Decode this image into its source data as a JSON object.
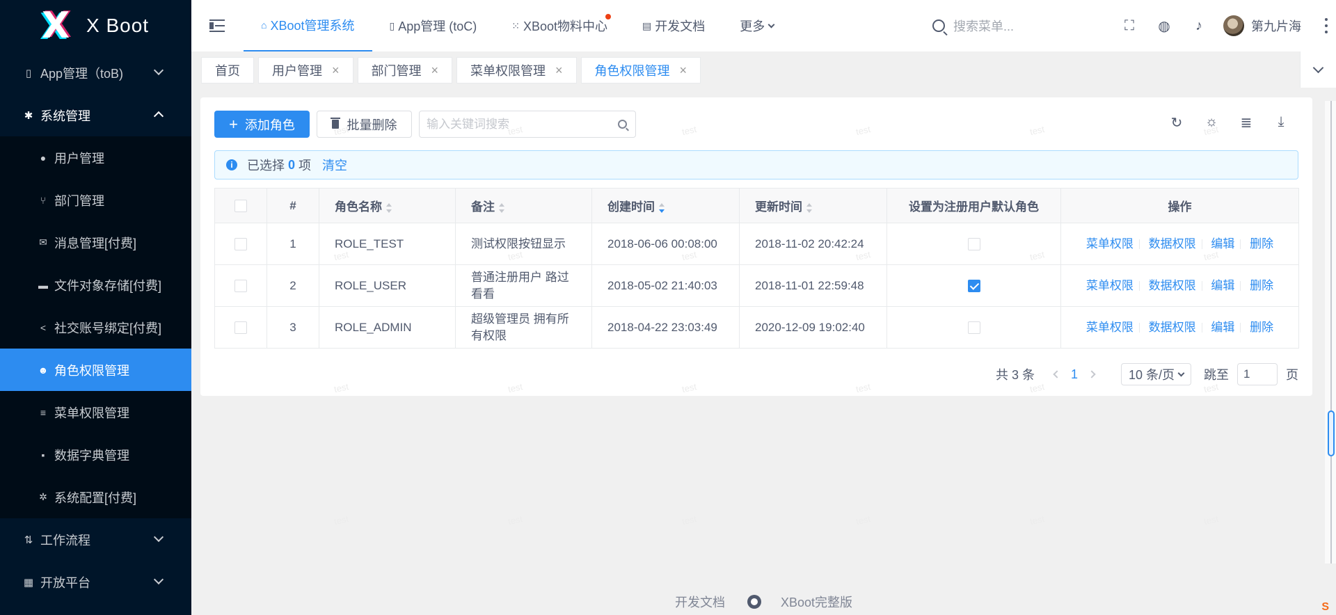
{
  "brand": {
    "name": "X Boot",
    "logo_letter": "X"
  },
  "sidebar": {
    "items": [
      {
        "label": "App管理（toB)",
        "icon": "mobile-icon",
        "glyph": "▯"
      },
      {
        "label": "系统管理",
        "icon": "gear-icon",
        "glyph": "✱"
      }
    ],
    "sub_items": [
      {
        "label": "用户管理",
        "icon": "user-icon",
        "glyph": "●"
      },
      {
        "label": "部门管理",
        "icon": "branch-icon",
        "glyph": "⑂"
      },
      {
        "label": "消息管理[付费]",
        "icon": "mail-icon",
        "glyph": "✉"
      },
      {
        "label": "文件对象存储[付费]",
        "icon": "folder-icon",
        "glyph": "▬"
      },
      {
        "label": "社交账号绑定[付费]",
        "icon": "share-icon",
        "glyph": "<"
      },
      {
        "label": "角色权限管理",
        "icon": "people-icon",
        "glyph": "☻"
      },
      {
        "label": "菜单权限管理",
        "icon": "list-icon",
        "glyph": "≡"
      },
      {
        "label": "数据字典管理",
        "icon": "book-icon",
        "glyph": "▪"
      },
      {
        "label": "系统配置[付费]",
        "icon": "cog-icon",
        "glyph": "✲"
      }
    ],
    "bottom_items": [
      {
        "label": "工作流程",
        "icon": "flow-icon",
        "glyph": "⇅"
      },
      {
        "label": "开放平台",
        "icon": "grid-icon",
        "glyph": "▦"
      }
    ],
    "active": "角色权限管理"
  },
  "header": {
    "nav": [
      {
        "label": "XBoot管理系统",
        "icon": "home-icon",
        "glyph": "⌂"
      },
      {
        "label": "App管理 (toC)",
        "icon": "mobile-icon",
        "glyph": "▯"
      },
      {
        "label": "XBoot物料中心",
        "icon": "apps-icon",
        "glyph": "⁙"
      },
      {
        "label": "开发文档",
        "icon": "document-icon",
        "glyph": "▤"
      },
      {
        "label": "更多"
      }
    ],
    "search_placeholder": "搜索菜单...",
    "username": "第九片海"
  },
  "tabs": [
    {
      "label": "首页"
    },
    {
      "label": "用户管理"
    },
    {
      "label": "部门管理"
    },
    {
      "label": "菜单权限管理"
    },
    {
      "label": "角色权限管理"
    }
  ],
  "toolbar": {
    "add_label": "添加角色",
    "batch_delete_label": "批量删除",
    "keyword_placeholder": "输入关键词搜索"
  },
  "selection": {
    "prefix": "已选择",
    "count": "0",
    "suffix": "项",
    "clear": "清空"
  },
  "table": {
    "headers": {
      "index": "#",
      "name": "角色名称",
      "remark": "备注",
      "created": "创建时间",
      "updated": "更新时间",
      "default": "设置为注册用户默认角色",
      "ops": "操作"
    },
    "rows": [
      {
        "index": "1",
        "name": "ROLE_TEST",
        "remark": "测试权限按钮显示",
        "created": "2018-06-06 00:08:00",
        "updated": "2018-11-02 20:42:24",
        "default": false
      },
      {
        "index": "2",
        "name": "ROLE_USER",
        "remark": "普通注册用户 路过看看",
        "created": "2018-05-02 21:40:03",
        "updated": "2018-11-01 22:59:48",
        "default": true
      },
      {
        "index": "3",
        "name": "ROLE_ADMIN",
        "remark": "超级管理员 拥有所有权限",
        "created": "2018-04-22 23:03:49",
        "updated": "2020-12-09 19:02:40",
        "default": false
      }
    ],
    "actions": {
      "menu_perm": "菜单权限",
      "data_perm": "数据权限",
      "edit": "编辑",
      "delete": "删除"
    }
  },
  "pager": {
    "total": "共 3 条",
    "current": "1",
    "size": "10 条/页",
    "jump_label": "跳至",
    "jump_value": "1",
    "page_suffix": "页"
  },
  "watermark": "test",
  "footer": {
    "docs": "开发文档",
    "full": "XBoot完整版"
  },
  "colors": {
    "primary": "#2d8cf0",
    "sidebar": "#001529",
    "submenu": "#000c17"
  }
}
